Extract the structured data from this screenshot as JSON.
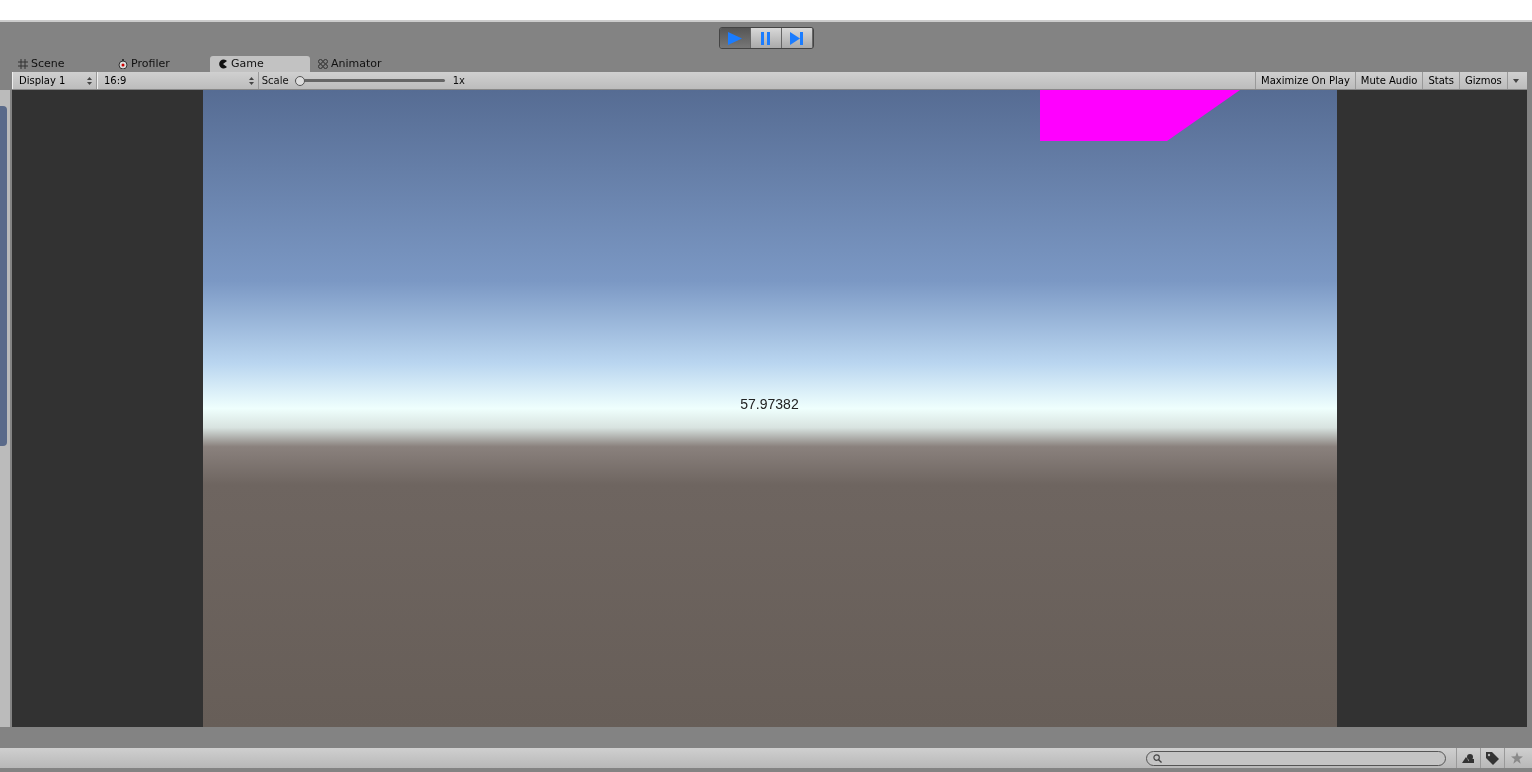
{
  "play_controls": [
    {
      "kind": "play",
      "selected": true
    },
    {
      "kind": "pause",
      "selected": false
    },
    {
      "kind": "step",
      "selected": false
    }
  ],
  "tabs": [
    {
      "label": "Scene",
      "selected": false
    },
    {
      "label": "Profiler",
      "selected": false
    },
    {
      "label": "Game",
      "selected": true
    },
    {
      "label": "Animator",
      "selected": false
    }
  ],
  "game_toolbar": {
    "display": "Display 1",
    "aspect": "16:9",
    "scale_label": "Scale",
    "scale": {
      "level": 0,
      "reading": "1x"
    },
    "toggles": [
      {
        "label": "Maximize On Play",
        "on": false
      },
      {
        "label": "Mute Audio",
        "on": false
      },
      {
        "label": "Stats",
        "on": false
      },
      {
        "label": "Gizmos",
        "on": false
      }
    ]
  },
  "game_view": {
    "text": "57.97382"
  }
}
